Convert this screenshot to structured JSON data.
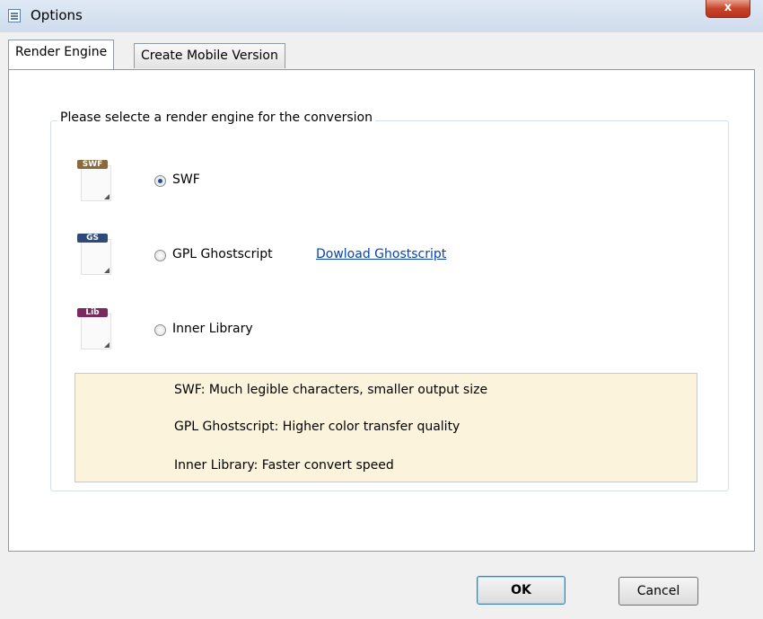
{
  "window": {
    "title": "Options",
    "close_label": "x"
  },
  "tabs": [
    {
      "label": "Render Engine",
      "selected": true
    },
    {
      "label": "Create Mobile Version",
      "selected": false
    }
  ],
  "group": {
    "label": "Please selecte a render engine for the conversion"
  },
  "engines": [
    {
      "badge": "SWF",
      "badge_color": "#8a6a3a",
      "label": "SWF",
      "checked": true
    },
    {
      "badge": "GS",
      "badge_color": "#2e4a78",
      "label": "GPL Ghostscript",
      "checked": false,
      "link": "Dowload Ghostscript"
    },
    {
      "badge": "Lib",
      "badge_color": "#7a2a5e",
      "label": "Inner Library",
      "checked": false
    }
  ],
  "info": [
    "SWF: Much legible characters, smaller output size",
    "GPL Ghostscript: Higher color transfer quality",
    "Inner Library: Faster convert speed"
  ],
  "buttons": {
    "ok": "OK",
    "cancel": "Cancel"
  }
}
